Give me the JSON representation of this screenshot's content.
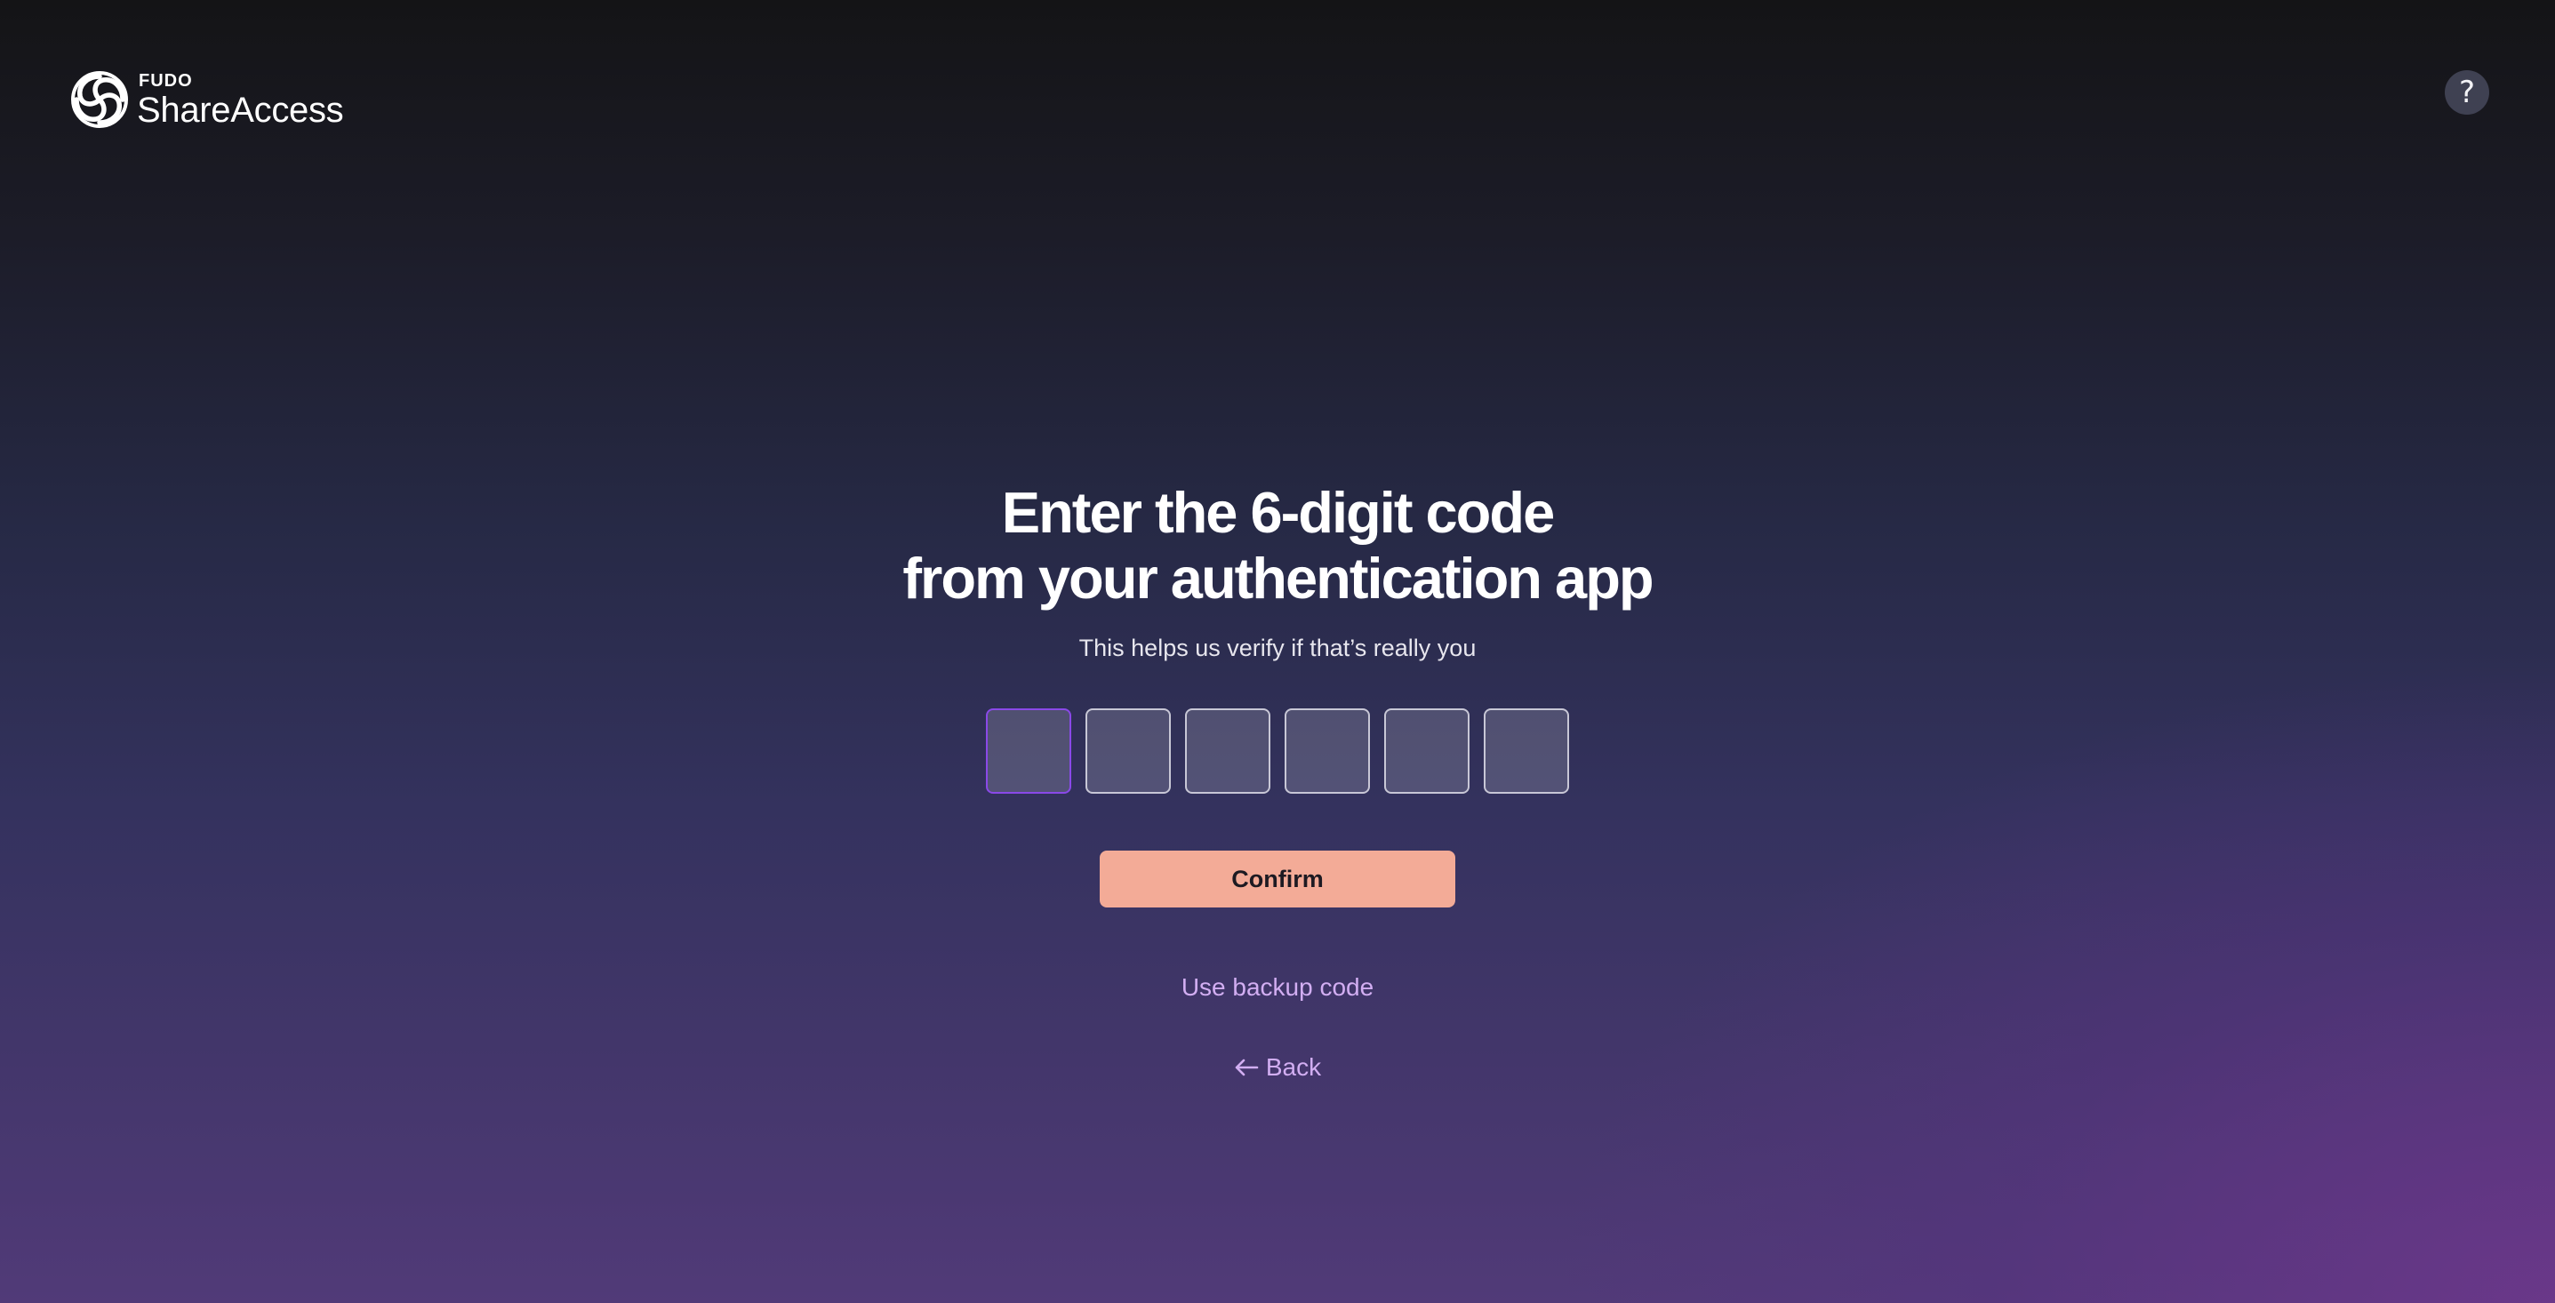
{
  "header": {
    "brand": "FUDO",
    "product": "ShareAccess",
    "help_label": "?",
    "logo_icon": "fudo-knot-logo",
    "help_icon": "question-mark-icon"
  },
  "main": {
    "title_line1": "Enter the 6-digit code",
    "title_line2": "from your authentication app",
    "subtitle": "This helps us verify if that’s really you",
    "code_inputs": [
      "",
      "",
      "",
      "",
      "",
      ""
    ],
    "confirm_label": "Confirm",
    "backup_label": "Use backup code",
    "back_label": "Back",
    "back_icon": "arrow-left-icon"
  },
  "colors": {
    "confirm_button": "#f3ab97",
    "link": "#d2aef2",
    "focus_border": "#8a49e8"
  }
}
